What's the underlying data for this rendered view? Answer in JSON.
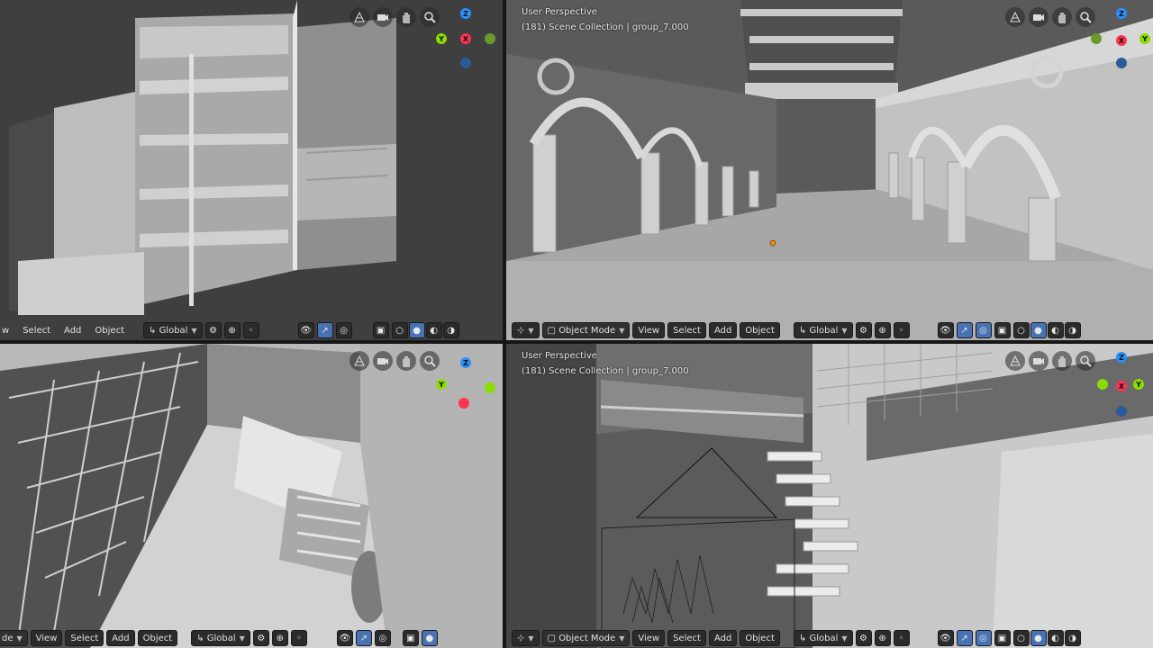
{
  "viewports": [
    {
      "id": "top-left",
      "overlay_title": "",
      "overlay_sub": "",
      "header": {
        "mode_label": "",
        "menu": [
          "w",
          "Select",
          "Add",
          "Object"
        ],
        "transform": "Global"
      },
      "gizmo": {
        "z": "Z",
        "y": "Y",
        "x": "X"
      }
    },
    {
      "id": "top-right",
      "overlay_title": "User Perspective",
      "overlay_sub": "(181) Scene Collection | group_7.000",
      "header": {
        "mode_label": "Object Mode",
        "menu": [
          "View",
          "Select",
          "Add",
          "Object"
        ],
        "transform": "Global"
      },
      "gizmo": {
        "z": "Z",
        "y": "Y",
        "x": "X"
      }
    },
    {
      "id": "bottom-left",
      "overlay_title": "",
      "overlay_sub": "",
      "header": {
        "mode_label": "de",
        "menu": [
          "View",
          "Select",
          "Add",
          "Object"
        ],
        "transform": "Global"
      },
      "gizmo": {
        "z": "Z",
        "y": "Y",
        "x": "X"
      }
    },
    {
      "id": "bottom-right",
      "overlay_title": "User Perspective",
      "overlay_sub": "(181) Scene Collection | group_7.000",
      "header": {
        "mode_label": "Object Mode",
        "menu": [
          "View",
          "Select",
          "Add",
          "Object"
        ],
        "transform": "Global"
      },
      "gizmo": {
        "z": "Z",
        "y": "Y",
        "x": "X"
      }
    }
  ],
  "colors": {
    "axis_x": "#ff3352",
    "axis_y": "#8bdc00",
    "axis_z": "#2890ff",
    "active_button": "#4772b3",
    "header_bg": "#2b2b2b"
  },
  "icons": {
    "nav": [
      "view-perspective-icon",
      "camera-icon",
      "hand-pan-icon",
      "zoom-icon"
    ]
  }
}
